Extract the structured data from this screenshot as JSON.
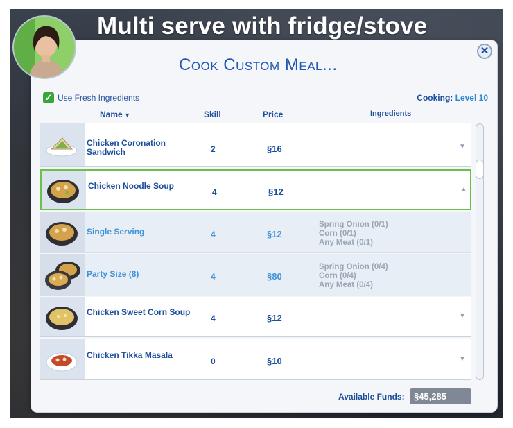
{
  "banner": "Multi serve with fridge/stove",
  "dialog": {
    "title": "Cook Custom Meal...",
    "fresh_ingredients_label": "Use Fresh Ingredients",
    "fresh_checked": true,
    "cooking_label": "Cooking:",
    "cooking_level": "Level 10",
    "close": "✕"
  },
  "columns": {
    "name": "Name",
    "skill": "Skill",
    "price": "Price",
    "ingredients": "Ingredients"
  },
  "rows": [
    {
      "name": "Chicken Coronation Sandwich",
      "skill": "2",
      "price": "§16",
      "chevron": "▼"
    },
    {
      "name": "Chicken Noodle Soup",
      "skill": "4",
      "price": "§12",
      "chevron": "▲"
    },
    {
      "name": "Single Serving",
      "skill": "4",
      "price": "§12",
      "ingredients": [
        "Spring Onion (0/1)",
        "Corn (0/1)",
        "Any Meat (0/1)"
      ]
    },
    {
      "name": "Party Size (8)",
      "skill": "4",
      "price": "§80",
      "ingredients": [
        "Spring Onion (0/4)",
        "Corn (0/4)",
        "Any Meat (0/4)"
      ]
    },
    {
      "name": "Chicken Sweet Corn Soup",
      "skill": "4",
      "price": "§12",
      "chevron": "▼"
    },
    {
      "name": "Chicken Tikka Masala",
      "skill": "0",
      "price": "§10",
      "chevron": "▼"
    }
  ],
  "footer": {
    "funds_label": "Available Funds:",
    "funds_value": "§45,285"
  },
  "icons": {
    "close": "close-icon",
    "sort": "sort-down-icon",
    "check": "checkmark-icon"
  },
  "colors": {
    "accent_blue": "#1d56b4",
    "selected_border": "#6cbf4a",
    "checkbox_green": "#38a53a"
  }
}
